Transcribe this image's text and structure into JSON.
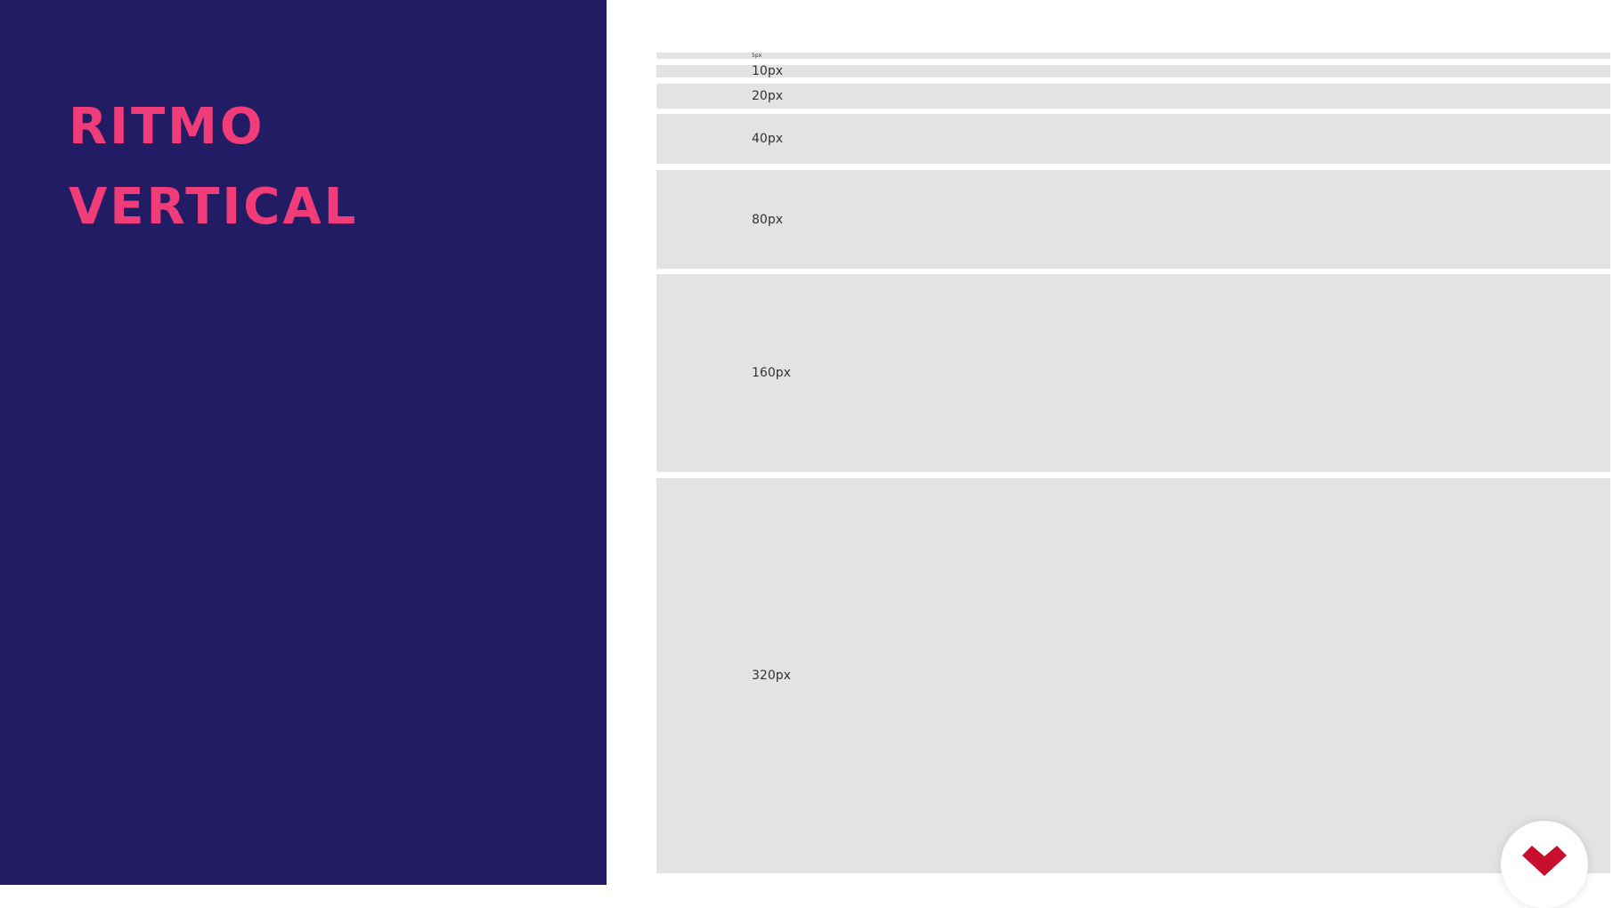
{
  "slide": {
    "title_line1": "RITMO",
    "title_line2": "VERTICAL",
    "colors": {
      "left_panel": "#211c64",
      "title": "#f03d7a",
      "bar": "#e4e2e5",
      "logo": "#c8102e"
    }
  },
  "bars": [
    {
      "label": "5px"
    },
    {
      "label": "10px"
    },
    {
      "label": "20px"
    },
    {
      "label": "40px"
    },
    {
      "label": "80px"
    },
    {
      "label": "160px"
    },
    {
      "label": "320px"
    }
  ],
  "logo": {
    "icon": "brand-chevron-heart-icon"
  }
}
